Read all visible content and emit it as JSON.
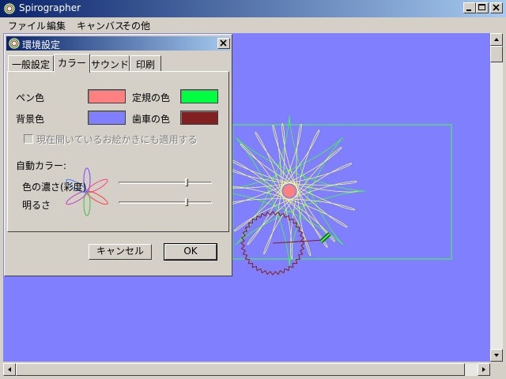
{
  "window": {
    "title": "Spirographer",
    "icon": "spiro-app-icon",
    "controls": [
      "minimize-icon",
      "maximize-icon",
      "close-icon"
    ]
  },
  "menu": {
    "file": "ファイル",
    "edit": "編集",
    "canvas": "キャンバス",
    "other": "その他"
  },
  "dialog": {
    "title": "環境設定",
    "tabs": [
      "一般設定",
      "カラー",
      "サウンド",
      "印刷"
    ],
    "active_tab": "カラー",
    "colors": {
      "pen_label": "ペン色",
      "pen_color": "#ff8080",
      "ruler_label": "定規の色",
      "ruler_color": "#00ff40",
      "background_label": "背景色",
      "background_color": "#8080ff",
      "gear_label": "歯車の色",
      "gear_color": "#802020"
    },
    "apply_checkbox": {
      "label": "現在開いているお絵かきにも適用する",
      "checked": false,
      "enabled": false
    },
    "auto_color": {
      "heading": "自動カラー:",
      "saturation_label": "色の濃さ(彩度)",
      "saturation_level": 0.73,
      "brightness_label": "明るさ",
      "brightness_level": 0.73
    },
    "buttons": {
      "cancel": "キャンセル",
      "ok": "OK"
    }
  },
  "canvas_colors": {
    "background": "#8080ff",
    "pattern_green": "#40ff40",
    "pattern_yellow": "#ffff80",
    "center": "#ff8080",
    "gear": "#802020"
  }
}
